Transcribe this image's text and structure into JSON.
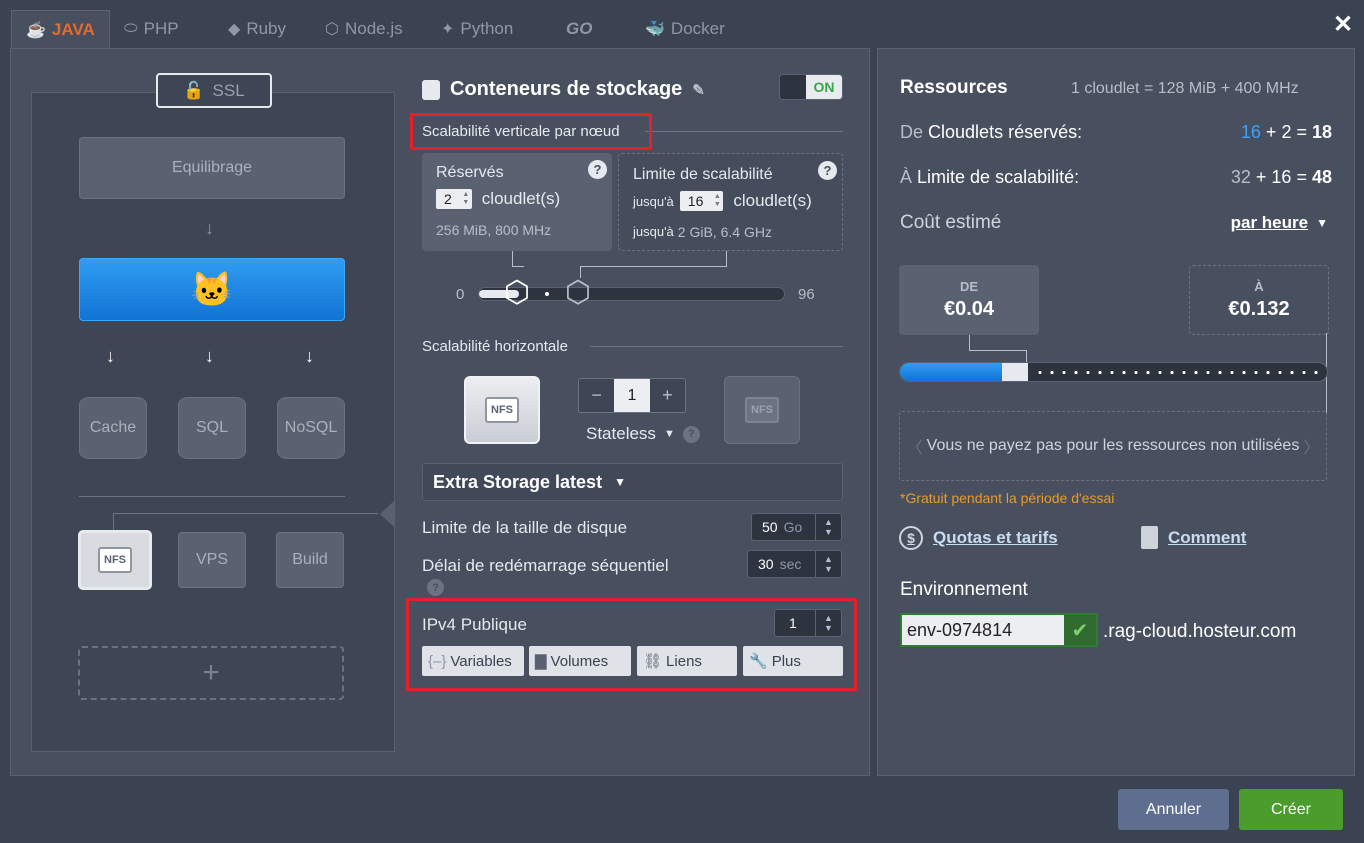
{
  "tabs": [
    {
      "label": "JAVA",
      "icon": "java-icon",
      "active": true
    },
    {
      "label": "PHP",
      "icon": "php-icon",
      "active": false
    },
    {
      "label": "Ruby",
      "icon": "ruby-icon",
      "active": false
    },
    {
      "label": "Node.js",
      "icon": "nodejs-icon",
      "active": false
    },
    {
      "label": "Python",
      "icon": "python-icon",
      "active": false
    },
    {
      "label": "GO",
      "icon": "go-icon",
      "active": false
    },
    {
      "label": "Docker",
      "icon": "docker-icon",
      "active": false
    }
  ],
  "topology": {
    "ssl_label": "SSL",
    "balancer_label": "Equilibrage",
    "db_nodes": [
      "Cache",
      "SQL",
      "NoSQL"
    ],
    "storage_badge": "NFS",
    "extra_nodes": [
      "VPS",
      "Build"
    ],
    "add_label": "+"
  },
  "center": {
    "title": "Conteneurs de stockage",
    "toggle_label": "ON",
    "vertical_label": "Scalabilité verticale par nœud",
    "reserved": {
      "title": "Réservés",
      "value": "2",
      "unit": "cloudlet(s)",
      "detail": "256 MiB, 800 MHz"
    },
    "limit": {
      "title": "Limite de scalabilité",
      "prefix": "jusqu'à",
      "value": "16",
      "unit": "cloudlet(s)",
      "detail_prefix": "jusqu'à",
      "detail": "2 GiB, 6.4 GHz"
    },
    "slider_min": "0",
    "slider_max": "96",
    "horizontal_label": "Scalabilité horizontale",
    "nfs_badge": "NFS",
    "counter": {
      "minus": "−",
      "value": "1",
      "plus": "+"
    },
    "mode": "Stateless",
    "storage_select": "Extra Storage latest",
    "disk_limit": {
      "label": "Limite de la taille de disque",
      "value": "50",
      "unit": "Go"
    },
    "restart_delay": {
      "label": "Délai de redémarrage séquentiel",
      "value": "30",
      "unit": "sec"
    },
    "ipv4": {
      "label": "IPv4 Publique",
      "value": "1"
    },
    "buttons": [
      "Variables",
      "Volumes",
      "Liens",
      "Plus"
    ]
  },
  "resources": {
    "title": "Ressources",
    "cloudlet_def": "1 cloudlet = 128 MiB + 400 MHz",
    "reserved_prefix": "De",
    "reserved_label": "Cloudlets réservés:",
    "reserved_a": "16",
    "reserved_b": "2",
    "reserved_total": "18",
    "limit_prefix": "À",
    "limit_label": "Limite de scalabilité:",
    "limit_a": "32",
    "limit_b": "16",
    "limit_total": "48",
    "cost_label": "Coût estimé",
    "cost_period": "par heure",
    "from_label": "DE",
    "from_price": "€0.04",
    "to_label": "À",
    "to_price": "€0.132",
    "info": "Vous ne payez pas pour les ressources non utilisées",
    "trial": "*Gratuit pendant la période d'essai",
    "link_quotas": "Quotas et tarifs",
    "link_how": "Comment",
    "env_label": "Environnement",
    "env_name": "env-0974814",
    "env_domain": ".rag-cloud.hosteur.com"
  },
  "footer": {
    "cancel": "Annuler",
    "create": "Créer"
  },
  "colors": {
    "accent_orange": "#e8692a",
    "primary_blue": "#1273d4",
    "create_green": "#4a9d2d",
    "highlight_red": "#e4202b"
  }
}
